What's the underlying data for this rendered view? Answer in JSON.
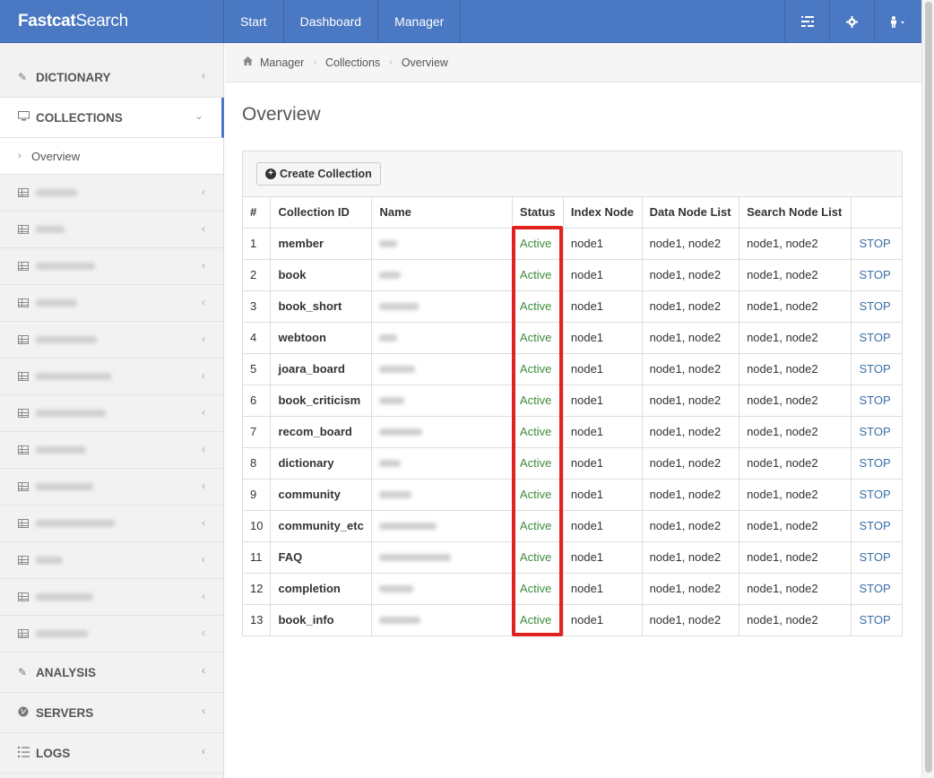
{
  "brand": {
    "bold": "Fastcat",
    "light": "Search"
  },
  "topnav": {
    "items": [
      "Start",
      "Dashboard",
      "Manager"
    ],
    "icons": [
      "list-icon",
      "gear-icon",
      "user-icon"
    ]
  },
  "sidebar": {
    "dictionary": "DICTIONARY",
    "collections": "COLLECTIONS",
    "overview": "Overview",
    "hidden_collection_count": 13,
    "analysis": "ANALYSIS",
    "servers": "SERVERS",
    "logs": "LOGS"
  },
  "breadcrumb": {
    "items": [
      "Manager",
      "Collections",
      "Overview"
    ]
  },
  "page": {
    "title": "Overview"
  },
  "panel": {
    "create_label": "Create Collection"
  },
  "table": {
    "headers": [
      "#",
      "Collection ID",
      "Name",
      "Status",
      "Index Node",
      "Data Node List",
      "Search Node List",
      ""
    ],
    "rows": [
      {
        "num": "1",
        "id": "member",
        "status": "Active",
        "index": "node1",
        "data": "node1, node2",
        "search": "node1, node2",
        "action": "STOP"
      },
      {
        "num": "2",
        "id": "book",
        "status": "Active",
        "index": "node1",
        "data": "node1, node2",
        "search": "node1, node2",
        "action": "STOP"
      },
      {
        "num": "3",
        "id": "book_short",
        "status": "Active",
        "index": "node1",
        "data": "node1, node2",
        "search": "node1, node2",
        "action": "STOP"
      },
      {
        "num": "4",
        "id": "webtoon",
        "status": "Active",
        "index": "node1",
        "data": "node1, node2",
        "search": "node1, node2",
        "action": "STOP"
      },
      {
        "num": "5",
        "id": "joara_board",
        "status": "Active",
        "index": "node1",
        "data": "node1, node2",
        "search": "node1, node2",
        "action": "STOP"
      },
      {
        "num": "6",
        "id": "book_criticism",
        "status": "Active",
        "index": "node1",
        "data": "node1, node2",
        "search": "node1, node2",
        "action": "STOP"
      },
      {
        "num": "7",
        "id": "recom_board",
        "status": "Active",
        "index": "node1",
        "data": "node1, node2",
        "search": "node1, node2",
        "action": "STOP"
      },
      {
        "num": "8",
        "id": "dictionary",
        "status": "Active",
        "index": "node1",
        "data": "node1, node2",
        "search": "node1, node2",
        "action": "STOP"
      },
      {
        "num": "9",
        "id": "community",
        "status": "Active",
        "index": "node1",
        "data": "node1, node2",
        "search": "node1, node2",
        "action": "STOP"
      },
      {
        "num": "10",
        "id": "community_etc",
        "status": "Active",
        "index": "node1",
        "data": "node1, node2",
        "search": "node1, node2",
        "action": "STOP"
      },
      {
        "num": "11",
        "id": "FAQ",
        "status": "Active",
        "index": "node1",
        "data": "node1, node2",
        "search": "node1, node2",
        "action": "STOP"
      },
      {
        "num": "12",
        "id": "completion",
        "status": "Active",
        "index": "node1",
        "data": "node1, node2",
        "search": "node1, node2",
        "action": "STOP"
      },
      {
        "num": "13",
        "id": "book_info",
        "status": "Active",
        "index": "node1",
        "data": "node1, node2",
        "search": "node1, node2",
        "action": "STOP"
      }
    ]
  },
  "colors": {
    "navbar": "#4a78c2",
    "status_active": "#3c8d3c",
    "link": "#3a6ea5",
    "highlight": "#e0231f"
  }
}
